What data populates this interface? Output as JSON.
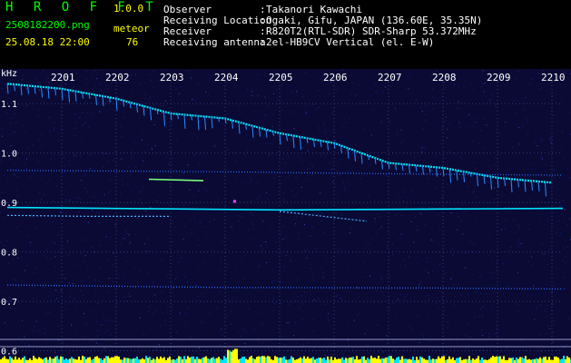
{
  "app": {
    "title": "H R O F F T",
    "version": "1.0.0",
    "filename": "2508182200.png",
    "datetime": "25.08.18 22:00",
    "count_label": "meteor",
    "count_value": "76"
  },
  "info": [
    {
      "key": "Observer",
      "value": "Takanori Kawachi"
    },
    {
      "key": "Receiving Location",
      "value": "Ogaki, Gifu, JAPAN (136.60E, 35.35N)"
    },
    {
      "key": "Receiver",
      "value": "R820T2(RTL-SDR) SDR-Sharp 53.372MHz"
    },
    {
      "key": "Receiving antenna",
      "value": "2el-HB9CV Vertical (el. E-W)"
    }
  ],
  "colors": {
    "background": "#0a0a35",
    "text_green": "#00ff00",
    "text_yellow": "#ffff00",
    "text_white": "#ffffff",
    "grid": "#3a3a70",
    "signal_cyan": "#00e5ff",
    "signal_blue": "#2a6bff",
    "meteor_bar": "#ffff00"
  },
  "chart_data": {
    "type": "heatmap",
    "ylabel": "kHz",
    "x_ticks": [
      "2201",
      "2202",
      "2203",
      "2204",
      "2205",
      "2206",
      "2207",
      "2208",
      "2209",
      "2210"
    ],
    "y_ticks": [
      "1.1",
      "1.0",
      "0.9",
      "0.8",
      "0.7",
      "0.6"
    ],
    "ylim": [
      0.59,
      1.17
    ],
    "traces": [
      {
        "name": "",
        "points": [
          [
            2200.0,
            1.14
          ],
          [
            2201.0,
            1.13
          ],
          [
            2202.0,
            1.11
          ],
          [
            2203.0,
            1.08
          ],
          [
            2204.0,
            1.07
          ],
          [
            2205.0,
            1.04
          ],
          [
            2206.0,
            1.02
          ],
          [
            2207.0,
            0.98
          ],
          [
            2208.0,
            0.97
          ],
          [
            2209.0,
            0.95
          ],
          [
            2210.0,
            0.94
          ]
        ]
      },
      {
        "name": "",
        "points": [
          [
            2200.0,
            0.965
          ],
          [
            2204.0,
            0.962
          ],
          [
            2207.0,
            0.958
          ],
          [
            2210.2,
            0.955
          ]
        ]
      },
      {
        "name": "",
        "points": [
          [
            2200.0,
            0.89
          ],
          [
            2203.0,
            0.887
          ],
          [
            2205.0,
            0.885
          ],
          [
            2207.0,
            0.886
          ],
          [
            2210.2,
            0.888
          ]
        ]
      },
      {
        "name": "",
        "points": [
          [
            2200.0,
            0.733
          ],
          [
            2204.0,
            0.728
          ],
          [
            2208.0,
            0.727
          ],
          [
            2210.2,
            0.725
          ]
        ]
      },
      {
        "name": "",
        "points": [
          [
            2202.6,
            0.947
          ],
          [
            2203.6,
            0.944
          ]
        ]
      },
      {
        "name": "",
        "points": [
          [
            2200.0,
            0.874
          ],
          [
            2201.5,
            0.872
          ],
          [
            2203.0,
            0.872
          ]
        ]
      },
      {
        "name": "",
        "points": [
          [
            2205.0,
            0.882
          ],
          [
            2206.6,
            0.862
          ]
        ]
      }
    ],
    "grid": true,
    "legend": "none"
  }
}
